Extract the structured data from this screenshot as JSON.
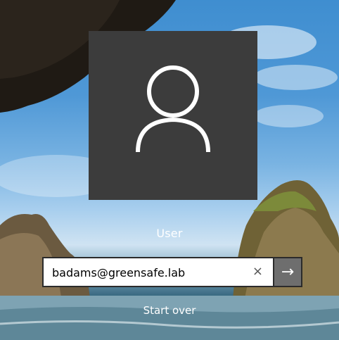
{
  "user": {
    "name": "User",
    "avatar_icon": "user-icon"
  },
  "signin": {
    "value": "badams@greensafe.lab",
    "clear_icon": "close-icon",
    "clear_glyph": "×",
    "submit_icon": "arrow-right-icon",
    "submit_glyph": "→"
  },
  "links": {
    "start_over": "Start over"
  },
  "colors": {
    "tile": "#3c3c3c",
    "submit_bg": "#6e6e6e",
    "text": "#ffffff"
  }
}
